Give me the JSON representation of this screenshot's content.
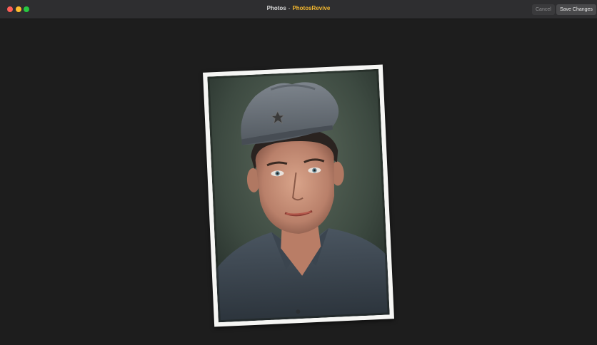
{
  "window": {
    "title_app": "Photos",
    "title_separator": "-",
    "title_extension": "PhotosRevive"
  },
  "toolbar": {
    "cancel_label": "Cancel",
    "save_label": "Save Changes"
  },
  "colors": {
    "background": "#1d1d1d",
    "titlebar": "#2e2e30",
    "accent_extension": "#f5b82e",
    "close": "#ff5f57",
    "minimize": "#febc2e",
    "maximize": "#28c840"
  },
  "photo": {
    "subject": "colorized portrait of a young soldier in side cap"
  }
}
